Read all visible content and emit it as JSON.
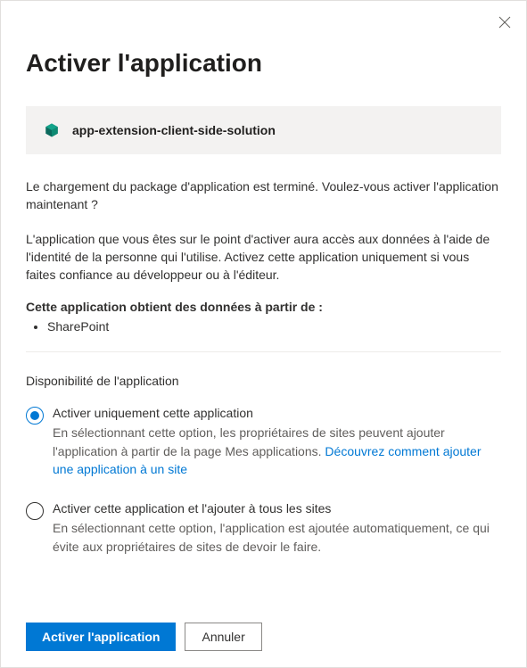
{
  "dialog": {
    "title": "Activer l'application"
  },
  "app": {
    "name": "app-extension-client-side-solution"
  },
  "body": {
    "intro": "Le chargement du package d'application est terminé. Voulez-vous activer l'application maintenant ?",
    "warning": "L'application que vous êtes sur le point d'activer aura accès aux données à l'aide de l'identité de la personne qui l'utilise. Activez cette application uniquement si vous faites confiance au développeur ou à l'éditeur.",
    "sourcesLabel": "Cette application obtient des données à partir de :",
    "sources": [
      "SharePoint"
    ]
  },
  "availability": {
    "title": "Disponibilité de l'application",
    "options": [
      {
        "label": "Activer uniquement cette application",
        "descPrefix": "En sélectionnant cette option, les propriétaires de sites peuvent ajouter l'application à partir de la page Mes applications. ",
        "linkText": "Découvrez comment ajouter une application à un site",
        "selected": true
      },
      {
        "label": "Activer cette application et l'ajouter à tous les sites",
        "descPrefix": "En sélectionnant cette option, l'application est ajoutée automatiquement, ce qui évite aux propriétaires de sites de devoir le faire.",
        "linkText": "",
        "selected": false
      }
    ]
  },
  "footer": {
    "primary": "Activer l'application",
    "secondary": "Annuler"
  }
}
